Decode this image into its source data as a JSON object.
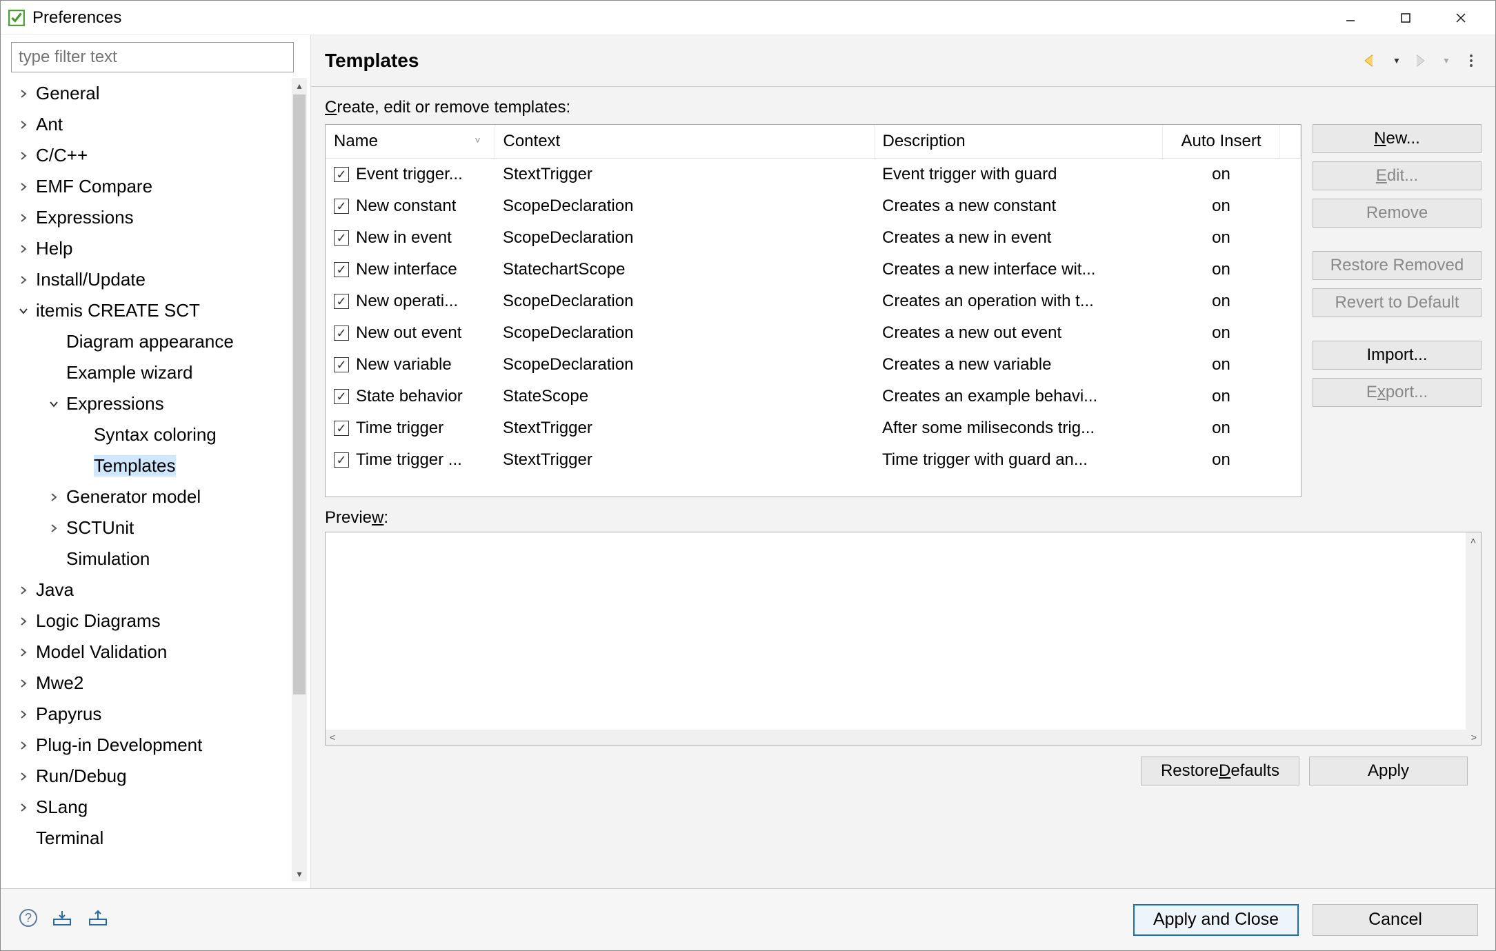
{
  "window": {
    "title": "Preferences"
  },
  "filter": {
    "placeholder": "type filter text"
  },
  "tree": [
    {
      "label": "General",
      "depth": 0,
      "expandable": true,
      "open": false
    },
    {
      "label": "Ant",
      "depth": 0,
      "expandable": true,
      "open": false
    },
    {
      "label": "C/C++",
      "depth": 0,
      "expandable": true,
      "open": false
    },
    {
      "label": "EMF Compare",
      "depth": 0,
      "expandable": true,
      "open": false
    },
    {
      "label": "Expressions",
      "depth": 0,
      "expandable": true,
      "open": false
    },
    {
      "label": "Help",
      "depth": 0,
      "expandable": true,
      "open": false
    },
    {
      "label": "Install/Update",
      "depth": 0,
      "expandable": true,
      "open": false
    },
    {
      "label": "itemis CREATE SCT",
      "depth": 0,
      "expandable": true,
      "open": true
    },
    {
      "label": "Diagram appearance",
      "depth": 1,
      "expandable": false
    },
    {
      "label": "Example wizard",
      "depth": 1,
      "expandable": false
    },
    {
      "label": "Expressions",
      "depth": 1,
      "expandable": true,
      "open": true
    },
    {
      "label": "Syntax coloring",
      "depth": 2,
      "expandable": false
    },
    {
      "label": "Templates",
      "depth": 2,
      "expandable": false,
      "selected": true
    },
    {
      "label": "Generator model",
      "depth": 1,
      "expandable": true,
      "open": false
    },
    {
      "label": "SCTUnit",
      "depth": 1,
      "expandable": true,
      "open": false
    },
    {
      "label": "Simulation",
      "depth": 1,
      "expandable": false
    },
    {
      "label": "Java",
      "depth": 0,
      "expandable": true,
      "open": false
    },
    {
      "label": "Logic Diagrams",
      "depth": 0,
      "expandable": true,
      "open": false
    },
    {
      "label": "Model Validation",
      "depth": 0,
      "expandable": true,
      "open": false
    },
    {
      "label": "Mwe2",
      "depth": 0,
      "expandable": true,
      "open": false
    },
    {
      "label": "Papyrus",
      "depth": 0,
      "expandable": true,
      "open": false
    },
    {
      "label": "Plug-in Development",
      "depth": 0,
      "expandable": true,
      "open": false
    },
    {
      "label": "Run/Debug",
      "depth": 0,
      "expandable": true,
      "open": false
    },
    {
      "label": "SLang",
      "depth": 0,
      "expandable": true,
      "open": false
    },
    {
      "label": "Terminal",
      "depth": 0,
      "expandable": false
    }
  ],
  "page": {
    "title": "Templates",
    "section_label": "Create, edit or remove templates:",
    "preview_label": "Preview:"
  },
  "columns": {
    "name": "Name",
    "context": "Context",
    "description": "Description",
    "auto": "Auto Insert"
  },
  "rows": [
    {
      "checked": true,
      "name": "Event trigger...",
      "context": "StextTrigger",
      "description": "Event trigger with guard",
      "auto": "on"
    },
    {
      "checked": true,
      "name": "New constant",
      "context": "ScopeDeclaration",
      "description": "Creates a new constant",
      "auto": "on"
    },
    {
      "checked": true,
      "name": "New in event",
      "context": "ScopeDeclaration",
      "description": "Creates a new in event",
      "auto": "on"
    },
    {
      "checked": true,
      "name": "New interface",
      "context": "StatechartScope",
      "description": "Creates a new interface wit...",
      "auto": "on"
    },
    {
      "checked": true,
      "name": "New operati...",
      "context": "ScopeDeclaration",
      "description": "Creates an operation with t...",
      "auto": "on"
    },
    {
      "checked": true,
      "name": "New out event",
      "context": "ScopeDeclaration",
      "description": "Creates a new out event",
      "auto": "on"
    },
    {
      "checked": true,
      "name": "New variable",
      "context": "ScopeDeclaration",
      "description": "Creates a new variable",
      "auto": "on"
    },
    {
      "checked": true,
      "name": "State behavior",
      "context": "StateScope",
      "description": "Creates an example behavi...",
      "auto": "on"
    },
    {
      "checked": true,
      "name": "Time trigger",
      "context": "StextTrigger",
      "description": "After some miliseconds trig...",
      "auto": "on"
    },
    {
      "checked": true,
      "name": "Time trigger ...",
      "context": "StextTrigger",
      "description": "Time trigger with guard an...",
      "auto": "on"
    }
  ],
  "buttons": {
    "new": "New...",
    "edit": "Edit...",
    "remove": "Remove",
    "restore_removed": "Restore Removed",
    "revert_default": "Revert to Default",
    "import": "Import...",
    "export": "Export...",
    "restore_defaults": "Restore Defaults",
    "apply": "Apply",
    "apply_close": "Apply and Close",
    "cancel": "Cancel"
  }
}
